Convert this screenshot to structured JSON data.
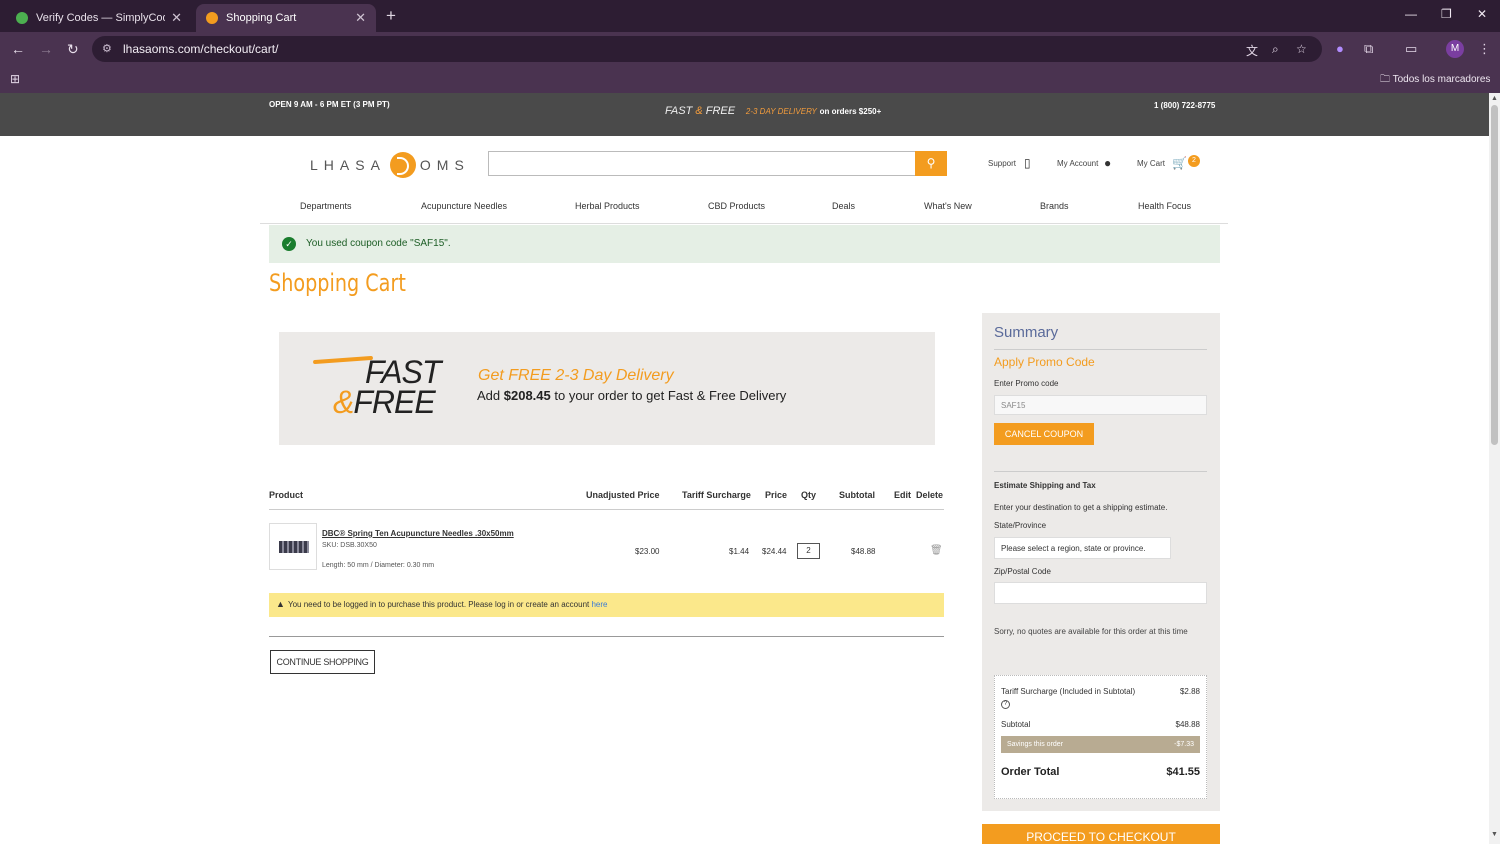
{
  "browser": {
    "tabs": [
      {
        "title": "Verify Codes — SimplyCodes",
        "favicon_color": "#4caf50"
      },
      {
        "title": "Shopping Cart",
        "favicon_color": "#f39c1f"
      }
    ],
    "url": "lhasaoms.com/checkout/cart/",
    "bookmarks_folder": "Todos los marcadores",
    "profile_initial": "M"
  },
  "topstrip": {
    "hours": "OPEN 9 AM - 6 PM ET (3 PM PT)",
    "fast": "FAST",
    "amp": "&",
    "free": "FREE",
    "delivery": "2-3 DAY DELIVERY",
    "orders": "on orders $250+",
    "phone": "1 (800) 722-8775"
  },
  "header": {
    "logo_left": "LHASA",
    "logo_right": "OMS",
    "support": "Support",
    "account": "My Account",
    "cart": "My Cart",
    "cart_count": "2"
  },
  "nav": [
    "Departments",
    "Acupuncture Needles",
    "Herbal Products",
    "CBD Products",
    "Deals",
    "What's New",
    "Brands",
    "Health Focus"
  ],
  "coupon_message": "You used coupon code \"SAF15\".",
  "page_title": "Shopping Cart",
  "banner": {
    "fast": "FAST",
    "amp": "&",
    "free": "FREE",
    "heading": "Get FREE 2-3 Day Delivery",
    "sub_pre": "Add ",
    "sub_amount": "$208.45",
    "sub_post": " to your order to get Fast & Free Delivery"
  },
  "table": {
    "headers": [
      "Product",
      "Unadjusted Price",
      "Tariff Surcharge",
      "Price",
      "Qty",
      "Subtotal",
      "Edit",
      "Delete"
    ],
    "item": {
      "name": "DBC® Spring Ten Acupuncture Needles .30x50mm",
      "sku": "SKU: DSB.30X50",
      "options": "Length: 50 mm / Diameter: 0.30 mm",
      "unadjusted": "$23.00",
      "tariff": "$1.44",
      "price": "$24.44",
      "qty": "2",
      "subtotal": "$48.88"
    }
  },
  "warning": {
    "text": "You need to be logged in to purchase this product. Please log in or create an account ",
    "link": "here"
  },
  "continue_label": "CONTINUE SHOPPING",
  "summary": {
    "title": "Summary",
    "promo_heading": "Apply Promo Code",
    "promo_label": "Enter Promo code",
    "promo_value": "SAF15",
    "cancel_label": "CANCEL COUPON",
    "ship_heading": "Estimate Shipping and Tax",
    "ship_desc": "Enter your destination to get a shipping estimate.",
    "state_label": "State/Province",
    "state_value": "Please select a region, state or province.",
    "zip_label": "Zip/Postal Code",
    "no_quotes": "Sorry, no quotes are available for this order at this time",
    "tariff_label": "Tariff Surcharge (Included in Subtotal)",
    "tariff_value": "$2.88",
    "subtotal_label": "Subtotal",
    "subtotal_value": "$48.88",
    "savings_label": "Savings this order",
    "savings_value": "-$7.33",
    "total_label": "Order Total",
    "total_value": "$41.55",
    "checkout_label": "PROCEED TO CHECKOUT"
  }
}
